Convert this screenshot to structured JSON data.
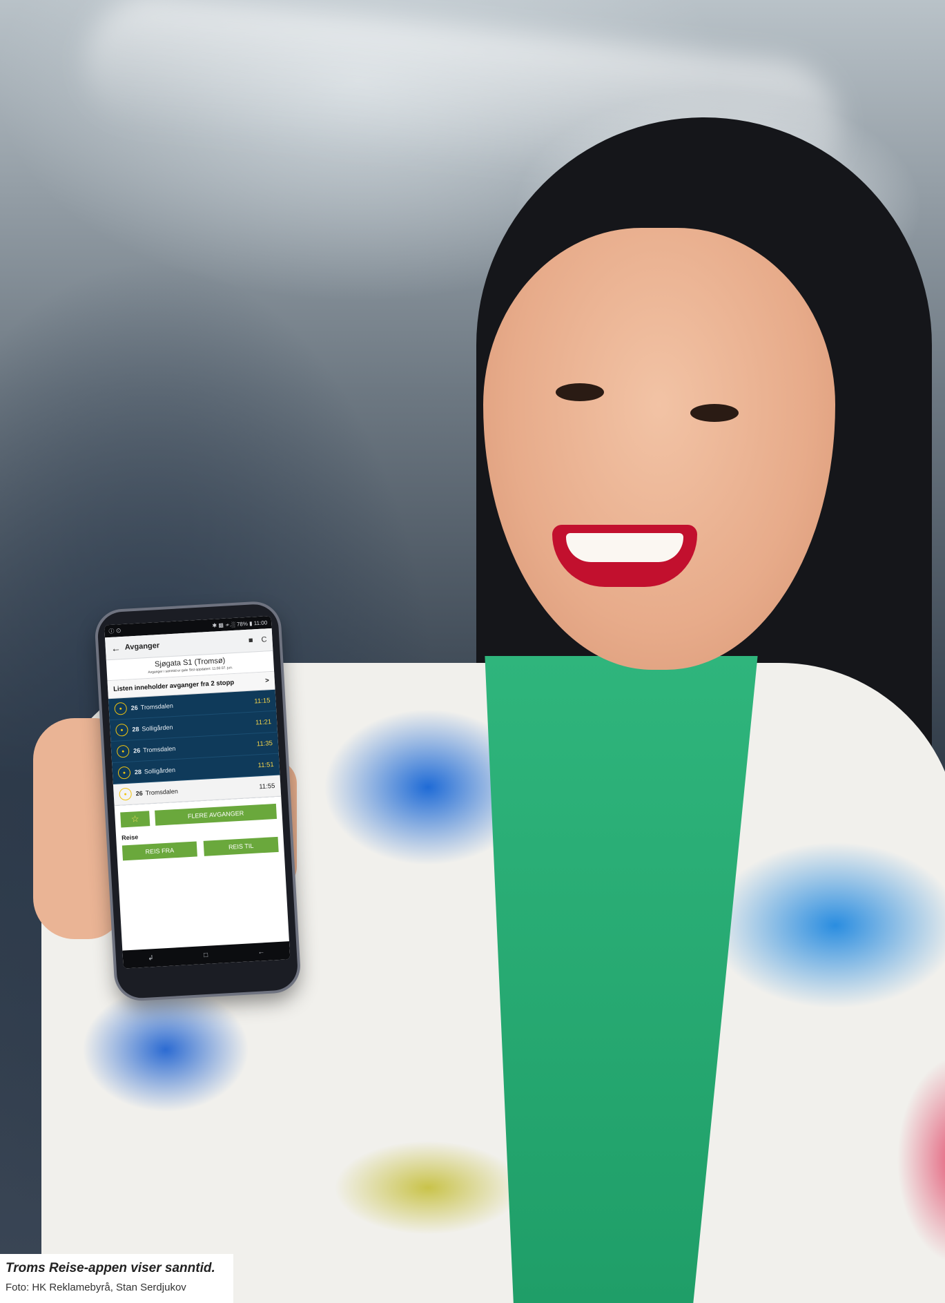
{
  "phone": {
    "statusbar": {
      "left": "ⓘ ⊙",
      "right": "✱ ▩ ≁.░ 78% ▮ 11:00"
    },
    "appbar": {
      "back_icon": "←",
      "title": "Avganger",
      "map_icon": "■",
      "refresh_icon": "C"
    },
    "stop": {
      "name": "Sjøgata S1 (Tromsø)",
      "subtitle": "Avganger i sanntid er gule Sist oppdatert: 11:00 07. jun."
    },
    "notice": {
      "text": "Listen inneholder avganger fra 2 stopp",
      "chevron": ">"
    },
    "departures": [
      {
        "line": "26",
        "destination": "Tromsdalen",
        "time": "11:15",
        "realtime": true
      },
      {
        "line": "28",
        "destination": "Solligården",
        "time": "11:21",
        "realtime": true
      },
      {
        "line": "26",
        "destination": "Tromsdalen",
        "time": "11:35",
        "realtime": true
      },
      {
        "line": "28",
        "destination": "Solligården",
        "time": "11:51",
        "realtime": true
      },
      {
        "line": "26",
        "destination": "Tromsdalen",
        "time": "11:55",
        "realtime": false
      }
    ],
    "favorite_icon": "☆",
    "more_button": "FLERE AVGANGER",
    "reise_label": "Reise",
    "reis_fra": "REIS FRA",
    "reis_til": "REIS TIL",
    "nav": {
      "recent": "↲",
      "home": "□",
      "back": "←"
    },
    "colors": {
      "accent": "#6aa83c",
      "list_bg": "#0f3a5a",
      "realtime": "#f3d34a"
    }
  },
  "caption": {
    "headline": "Troms Reise-appen viser sanntid.",
    "credit": "Foto: HK Reklamebyrå, Stan Serdjukov"
  }
}
